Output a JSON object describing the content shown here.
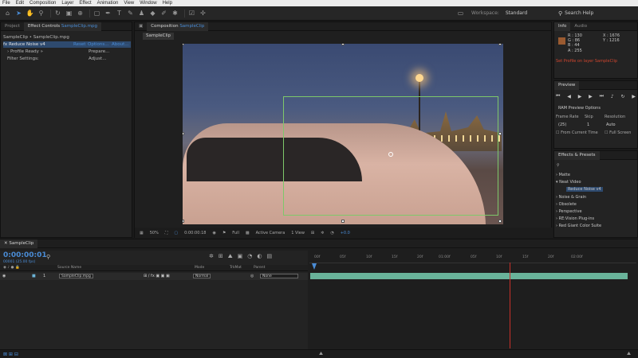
{
  "menu": [
    "File",
    "Edit",
    "Composition",
    "Layer",
    "Effect",
    "Animation",
    "View",
    "Window",
    "Help"
  ],
  "toolbar": {
    "workspace_label": "Workspace:",
    "workspace_value": "Standard",
    "search_placeholder": "Search Help"
  },
  "left_panel": {
    "tab_project": "Project",
    "tab_effect_controls": "Effect Controls",
    "tab_effect_controls_clip": "SampleClip.mpg",
    "breadcrumb": "SampleClip • SampleClip.mpg",
    "effect_name": "Reduce Noise v4",
    "effect_links": [
      "Reset",
      "Options...",
      "About..."
    ],
    "params": [
      {
        "label": "› Profile Ready »",
        "button": "Prepare..."
      },
      {
        "label": "Filter Settings:",
        "button": "Adjust..."
      }
    ]
  },
  "composition": {
    "tab_label": "Composition",
    "tab_comp": "SampleClip",
    "subtab": "SampleClip",
    "zoom": "50%",
    "timecode": "0:00:00:18",
    "resolution": "Full",
    "view": "Active Camera",
    "views": "1 View",
    "exposure": "+0.0"
  },
  "info": {
    "tab_info": "Info",
    "tab_audio": "Audio",
    "r": "R : 130",
    "g": "G : 86",
    "b": "B : 44",
    "a": "A : 255",
    "x": "X : 1676",
    "y": "Y : 1216",
    "message": "Set Profile on layer SampleClip"
  },
  "preview": {
    "title": "Preview",
    "ram_options": "RAM Preview Options",
    "frame_rate_label": "Frame Rate",
    "skip_label": "Skip",
    "resolution_label": "Resolution",
    "frame_rate": "(25)",
    "skip": "1",
    "resolution": "Auto",
    "from_current": "From Current Time",
    "full_screen": "Full Screen"
  },
  "effects_presets": {
    "title": "Effects & Presets",
    "items": [
      "› Matte",
      "▾ Neat Video",
      "› Noise & Grain",
      "› Obsolete",
      "› Perspective",
      "› RE:Vision Plug-ins",
      "› Red Giant Color Suite"
    ],
    "highlighted": "Reduce Noise v4"
  },
  "timeline": {
    "tab": "SampleClip",
    "timecode": "0:00:00:01",
    "frame_info": "00001 (25.00 fps)",
    "ticks": [
      "00f",
      "05f",
      "10f",
      "15f",
      "20f",
      "01:00f",
      "05f",
      "10f",
      "15f",
      "20f",
      "02:00f"
    ],
    "columns": {
      "source_name": "Source Name",
      "mode": "Mode",
      "trkmat": "TrkMat",
      "parent": "Parent"
    },
    "layer": {
      "index": "1",
      "name": "SampleClip.mpg",
      "mode": "Normal",
      "parent": "None"
    }
  }
}
